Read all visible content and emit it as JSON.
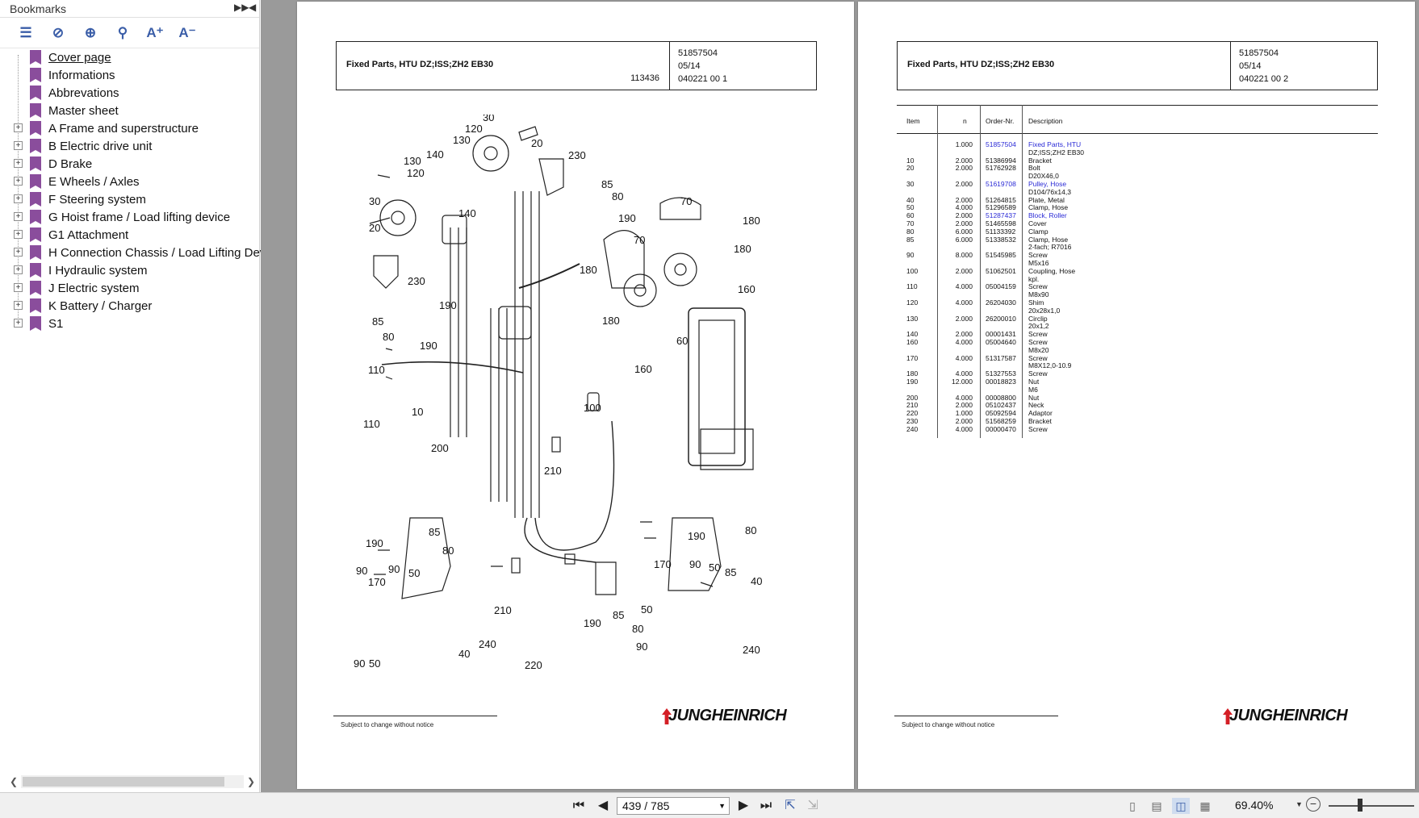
{
  "sidebar": {
    "title": "Bookmarks",
    "items": [
      {
        "label": "Cover page",
        "expandable": false,
        "current": true
      },
      {
        "label": "Informations",
        "expandable": false
      },
      {
        "label": "Abbrevations",
        "expandable": false
      },
      {
        "label": "Master sheet",
        "expandable": false
      },
      {
        "label": "A Frame and superstructure",
        "expandable": true
      },
      {
        "label": "B Electric drive unit",
        "expandable": true
      },
      {
        "label": "D Brake",
        "expandable": true
      },
      {
        "label": "E Wheels / Axles",
        "expandable": true
      },
      {
        "label": "F Steering system",
        "expandable": true
      },
      {
        "label": "G Hoist frame / Load lifting device",
        "expandable": true
      },
      {
        "label": "G1 Attachment",
        "expandable": true
      },
      {
        "label": "H Connection Chassis / Load Lifting Devi",
        "expandable": true
      },
      {
        "label": "I Hydraulic system",
        "expandable": true
      },
      {
        "label": "J Electric system",
        "expandable": true
      },
      {
        "label": "K Battery / Charger",
        "expandable": true
      },
      {
        "label": "S1",
        "expandable": true
      }
    ],
    "toolbar_icons": [
      "options-icon",
      "delete-bookmark-icon",
      "add-bookmark-icon",
      "find-bookmark-icon",
      "font-increase-icon",
      "font-decrease-icon"
    ]
  },
  "page1": {
    "title": "Fixed Parts, HTU DZ;ISS;ZH2 EB30",
    "drawing_no": "113436",
    "meta": [
      "51857504",
      "05/14",
      "040221 00 1"
    ],
    "footer": "Subject to change without notice",
    "brand": "JUNGHEINRICH"
  },
  "page2": {
    "title": "Fixed Parts, HTU DZ;ISS;ZH2 EB30",
    "meta": [
      "51857504",
      "05/14",
      "040221 00 2"
    ],
    "footer": "Subject to change without notice",
    "brand": "JUNGHEINRICH",
    "table": {
      "headers": {
        "item": "Item",
        "n": "n",
        "order": "Order-Nr.",
        "desc": "Description"
      },
      "rows": [
        {
          "item": "",
          "qty": "1.000",
          "order": "51857504",
          "desc": "Fixed Parts, HTU",
          "link": true
        },
        {
          "item": "",
          "qty": "",
          "order": "",
          "desc": "DZ;ISS;ZH2 EB30"
        },
        {
          "item": "10",
          "qty": "2.000",
          "order": "51386994",
          "desc": "Bracket"
        },
        {
          "item": "20",
          "qty": "2.000",
          "order": "51762928",
          "desc": "Bolt"
        },
        {
          "item": "",
          "qty": "",
          "order": "",
          "desc": "D20X46,0"
        },
        {
          "item": "30",
          "qty": "2.000",
          "order": "51619708",
          "desc": "Pulley, Hose",
          "link": true
        },
        {
          "item": "",
          "qty": "",
          "order": "",
          "desc": "D104/76x14,3"
        },
        {
          "item": "40",
          "qty": "2.000",
          "order": "51264815",
          "desc": "Plate, Metal"
        },
        {
          "item": "50",
          "qty": "4.000",
          "order": "51296589",
          "desc": "Clamp, Hose"
        },
        {
          "item": "60",
          "qty": "2.000",
          "order": "51287437",
          "desc": "Block, Roller",
          "link": true
        },
        {
          "item": "70",
          "qty": "2.000",
          "order": "51465598",
          "desc": "Cover"
        },
        {
          "item": "80",
          "qty": "6.000",
          "order": "51133392",
          "desc": "Clamp"
        },
        {
          "item": "85",
          "qty": "6.000",
          "order": "51338532",
          "desc": "Clamp, Hose"
        },
        {
          "item": "",
          "qty": "",
          "order": "",
          "desc": "2-fach; R7016"
        },
        {
          "item": "90",
          "qty": "8.000",
          "order": "51545985",
          "desc": "Screw"
        },
        {
          "item": "",
          "qty": "",
          "order": "",
          "desc": "M5x16"
        },
        {
          "item": "100",
          "qty": "2.000",
          "order": "51062501",
          "desc": "Coupling, Hose"
        },
        {
          "item": "",
          "qty": "",
          "order": "",
          "desc": "kpl."
        },
        {
          "item": "110",
          "qty": "4.000",
          "order": "05004159",
          "desc": "Screw"
        },
        {
          "item": "",
          "qty": "",
          "order": "",
          "desc": "M8x90"
        },
        {
          "item": "120",
          "qty": "4.000",
          "order": "26204030",
          "desc": "Shim"
        },
        {
          "item": "",
          "qty": "",
          "order": "",
          "desc": "20x28x1,0"
        },
        {
          "item": "130",
          "qty": "2.000",
          "order": "26200010",
          "desc": "Circlip"
        },
        {
          "item": "",
          "qty": "",
          "order": "",
          "desc": "20x1,2"
        },
        {
          "item": "140",
          "qty": "2.000",
          "order": "00001431",
          "desc": "Screw"
        },
        {
          "item": "160",
          "qty": "4.000",
          "order": "05004640",
          "desc": "Screw"
        },
        {
          "item": "",
          "qty": "",
          "order": "",
          "desc": "M8x20"
        },
        {
          "item": "170",
          "qty": "4.000",
          "order": "51317587",
          "desc": "Screw"
        },
        {
          "item": "",
          "qty": "",
          "order": "",
          "desc": "M8X12,0-10.9"
        },
        {
          "item": "180",
          "qty": "4.000",
          "order": "51327553",
          "desc": "Screw"
        },
        {
          "item": "190",
          "qty": "12.000",
          "order": "00018823",
          "desc": "Nut"
        },
        {
          "item": "",
          "qty": "",
          "order": "",
          "desc": "M6"
        },
        {
          "item": "200",
          "qty": "4.000",
          "order": "00008800",
          "desc": "Nut"
        },
        {
          "item": "210",
          "qty": "2.000",
          "order": "05102437",
          "desc": "Neck"
        },
        {
          "item": "220",
          "qty": "1.000",
          "order": "05092594",
          "desc": "Adaptor"
        },
        {
          "item": "230",
          "qty": "2.000",
          "order": "51568259",
          "desc": "Bracket"
        },
        {
          "item": "240",
          "qty": "4.000",
          "order": "00000470",
          "desc": "Screw"
        }
      ]
    }
  },
  "diagram_labels": [
    "30",
    "120",
    "130",
    "20",
    "230",
    "140",
    "130",
    "120",
    "85",
    "80",
    "190",
    "30",
    "140",
    "20",
    "70",
    "180",
    "180",
    "70",
    "180",
    "230",
    "160",
    "190",
    "85",
    "180",
    "80",
    "190",
    "60",
    "160",
    "110",
    "10",
    "110",
    "200",
    "100",
    "210",
    "85",
    "190",
    "80",
    "190",
    "80",
    "90",
    "90",
    "50",
    "170",
    "170",
    "90",
    "50",
    "85",
    "40",
    "210",
    "190",
    "85",
    "50",
    "50",
    "240",
    "80",
    "90",
    "90",
    "240",
    "40",
    "220"
  ],
  "bottombar": {
    "page_value": "439 / 785",
    "zoom": "69.40%"
  }
}
